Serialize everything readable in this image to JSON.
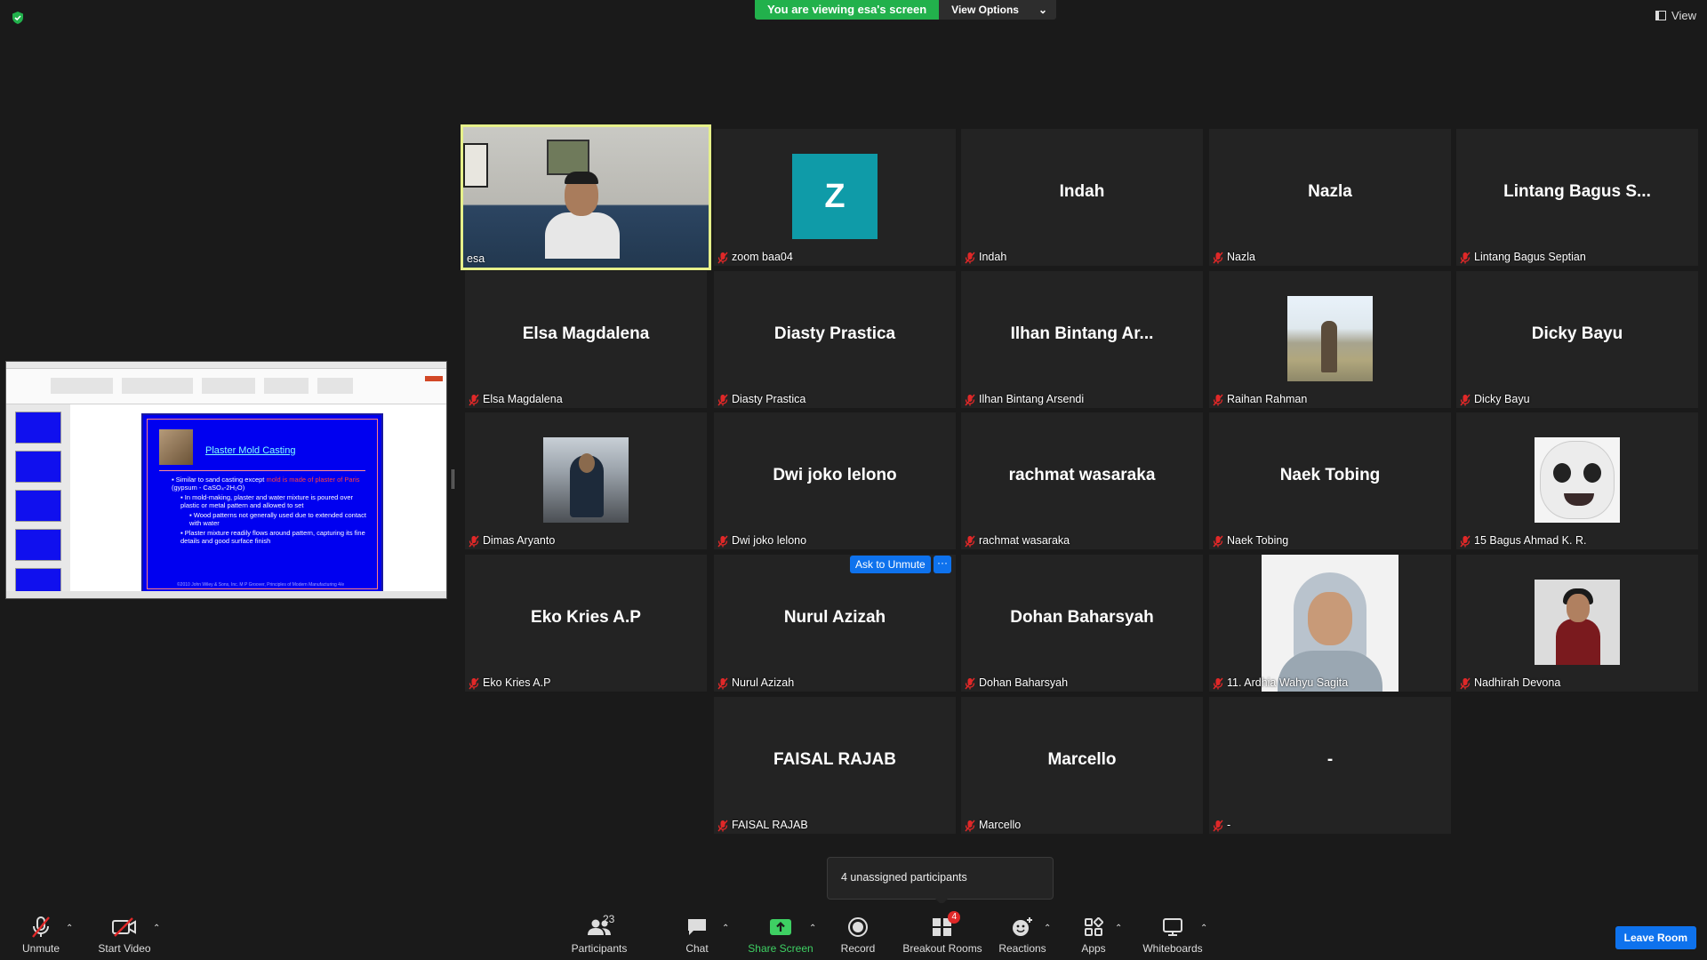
{
  "banner": {
    "viewing_text": "You are viewing esa's screen",
    "view_options_label": "View Options"
  },
  "view_label": "View",
  "slide": {
    "title": "Plaster Mold Casting",
    "bullet1_prefix": "Similar to sand casting except ",
    "bullet1_red": "mold is made of plaster of Paris",
    "bullet1_suffix": " (gypsum - CaSO₄-2H₂O)",
    "sub1": "In mold-making, plaster and water mixture is poured over plastic or metal pattern and allowed to set",
    "subsub1": "Wood patterns not generally used due to extended contact with water",
    "sub2": "Plaster mixture readily flows around pattern, capturing its fine details and good surface finish",
    "footer": "©2010 John Wiley & Sons, Inc. M P Groover, Principles of Modern Manufacturing 4/e"
  },
  "participants": [
    {
      "label": "esa",
      "big": "",
      "kind": "video-esa",
      "muted": false,
      "active": true
    },
    {
      "label": "zoom baa04",
      "big": "",
      "avatar_letter": "Z",
      "kind": "avatar",
      "muted": true
    },
    {
      "label": "Indah",
      "big": "Indah",
      "kind": "name",
      "muted": true
    },
    {
      "label": "Nazla",
      "big": "Nazla",
      "kind": "name",
      "muted": true
    },
    {
      "label": "Lintang Bagus Septian",
      "big": "Lintang Bagus S...",
      "kind": "name",
      "muted": true
    },
    {
      "label": "Elsa Magdalena",
      "big": "Elsa Magdalena",
      "kind": "name",
      "muted": true
    },
    {
      "label": "Diasty Prastica",
      "big": "Diasty Prastica",
      "kind": "name",
      "muted": true
    },
    {
      "label": "Ilhan Bintang Arsendi",
      "big": "Ilhan Bintang Ar...",
      "kind": "name",
      "muted": true
    },
    {
      "label": "Raihan Rahman",
      "big": "",
      "kind": "photo-raihan",
      "muted": true
    },
    {
      "label": "Dicky Bayu",
      "big": "Dicky Bayu",
      "kind": "name",
      "muted": true
    },
    {
      "label": "Dimas Aryanto",
      "big": "",
      "kind": "photo-dimas",
      "muted": true
    },
    {
      "label": "Dwi joko lelono",
      "big": "Dwi joko lelono",
      "kind": "name",
      "muted": true
    },
    {
      "label": "rachmat wasaraka",
      "big": "rachmat wasaraka",
      "kind": "name",
      "muted": true
    },
    {
      "label": "Naek Tobing",
      "big": "Naek Tobing",
      "kind": "name",
      "muted": true
    },
    {
      "label": "15 Bagus Ahmad K. R.",
      "big": "",
      "kind": "photo-bagus",
      "muted": true
    },
    {
      "label": "Eko Kries A.P",
      "big": "Eko Kries A.P",
      "kind": "name",
      "muted": true
    },
    {
      "label": "Nurul Azizah",
      "big": "Nurul Azizah",
      "kind": "name",
      "muted": true
    },
    {
      "label": "Dohan Baharsyah",
      "big": "Dohan Baharsyah",
      "kind": "name",
      "muted": true
    },
    {
      "label": "11. Ardhia Wahyu Sagita",
      "big": "",
      "kind": "photo-ardhia",
      "muted": true
    },
    {
      "label": "Nadhirah Devona",
      "big": "",
      "kind": "photo-nadhirah",
      "muted": true
    },
    {
      "label": "FAISAL RAJAB",
      "big": "FAISAL RAJAB",
      "kind": "name",
      "muted": true
    },
    {
      "label": "Marcello",
      "big": "Marcello",
      "kind": "name",
      "muted": true
    },
    {
      "label": "-",
      "big": "-",
      "kind": "name",
      "muted": true
    }
  ],
  "hover": {
    "ask_to_unmute": "Ask to Unmute",
    "more": "···"
  },
  "popup": {
    "text": "4 unassigned participants"
  },
  "toolbar": {
    "unmute": "Unmute",
    "start_video": "Start Video",
    "participants": "Participants",
    "participants_count": "23",
    "chat": "Chat",
    "share_screen": "Share Screen",
    "record": "Record",
    "breakout_rooms": "Breakout Rooms",
    "breakout_badge": "4",
    "reactions": "Reactions",
    "apps": "Apps",
    "whiteboards": "Whiteboards",
    "leave_room": "Leave Room"
  },
  "colors": {
    "accent_blue": "#0e72ed",
    "banner_green": "#22b14c",
    "active_speaker": "#e6f08a",
    "muted_red": "#e02828"
  }
}
